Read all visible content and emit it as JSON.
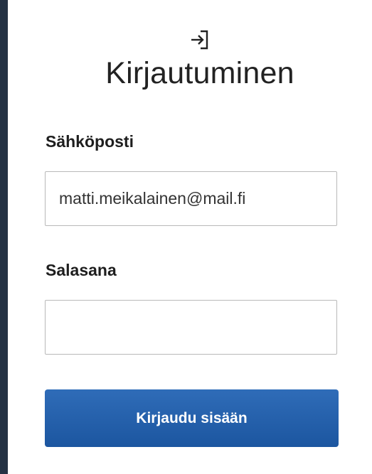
{
  "header": {
    "icon": "login-icon",
    "title": "Kirjautuminen"
  },
  "form": {
    "email_label": "Sähköposti",
    "email_value": "matti.meikalainen@mail.fi",
    "password_label": "Salasana",
    "password_value": "",
    "submit_label": "Kirjaudu sisään"
  },
  "colors": {
    "background": "#253244",
    "panel": "#ffffff",
    "button": "#2662ad",
    "input_border": "#b9b9b9"
  }
}
